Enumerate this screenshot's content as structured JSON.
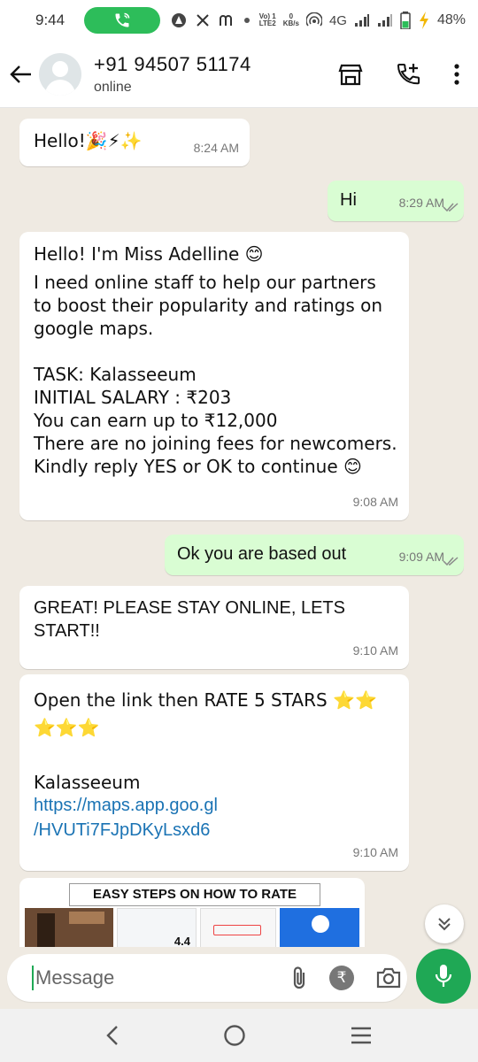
{
  "status_bar": {
    "time": "9:44",
    "network_top": "Vo) 1",
    "network_bottom": "LTE2",
    "speed_top": "0",
    "speed_bottom": "KB/s",
    "network_type": "4G",
    "battery": "48%"
  },
  "header": {
    "contact_name": "+91 94507 51174",
    "status": "online"
  },
  "messages": [
    {
      "dir": "in",
      "text": "Hello!🎉⚡✨",
      "time": "8:24 AM"
    },
    {
      "dir": "out",
      "text": "Hi",
      "time": "8:29 AM"
    },
    {
      "dir": "in",
      "line1": "Hello! I'm Miss Adelline 😊",
      "body": "I need online staff to help our partners\nto boost their popularity and ratings on\ngoogle maps.\n\nTASK: Kalasseeum\nINITIAL SALARY : ₹203\nYou can earn up to ₹12,000\nThere are no joining fees for newcomers.\nKindly reply YES or OK to continue 😊",
      "time": "9:08 AM"
    },
    {
      "dir": "out",
      "text": "Ok you are based out",
      "time": "9:09 AM"
    },
    {
      "dir": "in",
      "text": "GREAT! PLEASE STAY ONLINE, LETS\nSTART!!",
      "time": "9:10 AM"
    },
    {
      "dir": "in",
      "text": "Open the link then RATE 5 STARS ⭐⭐\n⭐⭐⭐\n\nKalasseeum",
      "link": "https://maps.app.goo.gl\n/HVUTi7FJpDKyLsxd6",
      "time": "9:10 AM"
    }
  ],
  "image_message": {
    "banner": "EASY STEPS ON HOW TO RATE",
    "rating_number": "4.4"
  },
  "input": {
    "placeholder": "Message",
    "rupee_symbol": "₹"
  },
  "colors": {
    "whatsapp_green": "#1fa855",
    "outgoing_bubble": "#d9fdd3",
    "chat_bg": "#efeae2",
    "link": "#1a73b4"
  }
}
